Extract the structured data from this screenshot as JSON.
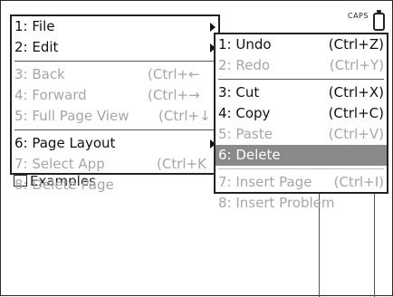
{
  "status": {
    "caps_label": "CAPS"
  },
  "background": {
    "item_label": "Examples"
  },
  "main_menu": [
    {
      "label": "1: File",
      "shortcut": "",
      "submenu": true,
      "disabled": false
    },
    {
      "label": "2: Edit",
      "shortcut": "",
      "submenu": true,
      "disabled": false
    },
    {
      "label": "3: Back",
      "shortcut": "(Ctrl+←",
      "submenu": false,
      "disabled": true
    },
    {
      "label": "4: Forward",
      "shortcut": "(Ctrl+→",
      "submenu": false,
      "disabled": true
    },
    {
      "label": "5: Full Page View",
      "shortcut": "(Ctrl+↓",
      "submenu": false,
      "disabled": true
    },
    {
      "label": "6: Page Layout",
      "shortcut": "",
      "submenu": true,
      "disabled": false
    },
    {
      "label": "7: Select App",
      "shortcut": "(Ctrl+K",
      "submenu": false,
      "disabled": true
    },
    {
      "label": "8: Delete Page",
      "shortcut": "",
      "submenu": false,
      "disabled": true
    }
  ],
  "edit_menu": [
    {
      "label": "1: Undo",
      "shortcut": "(Ctrl+Z)",
      "disabled": false,
      "selected": false
    },
    {
      "label": "2: Redo",
      "shortcut": "(Ctrl+Y)",
      "disabled": true,
      "selected": false
    },
    {
      "label": "3: Cut",
      "shortcut": "(Ctrl+X)",
      "disabled": false,
      "selected": false
    },
    {
      "label": "4: Copy",
      "shortcut": "(Ctrl+C)",
      "disabled": false,
      "selected": false
    },
    {
      "label": "5: Paste",
      "shortcut": "(Ctrl+V)",
      "disabled": true,
      "selected": false
    },
    {
      "label": "6: Delete",
      "shortcut": "",
      "disabled": false,
      "selected": true
    },
    {
      "label": "7: Insert Page",
      "shortcut": "(Ctrl+I)",
      "disabled": true,
      "selected": false
    },
    {
      "label": "8: Insert Problem",
      "shortcut": "",
      "disabled": true,
      "selected": false
    }
  ],
  "colors": {
    "selected_bg": "#8a8a8a",
    "disabled_text": "#a6a6a6"
  }
}
